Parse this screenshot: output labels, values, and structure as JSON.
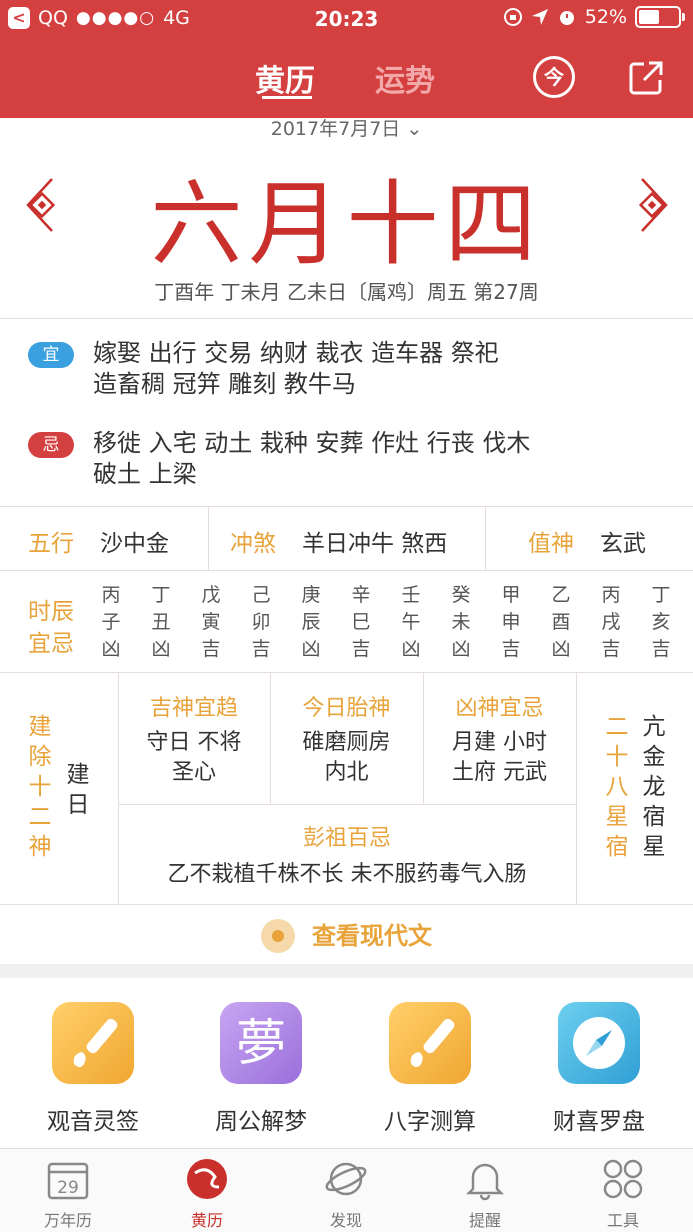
{
  "status_bar": {
    "carrier": "QQ",
    "signal": "●●●●○",
    "network": "4G",
    "time": "20:23",
    "battery": "52%",
    "battery_level": 0.52
  },
  "nav": {
    "tab_almanac": "黄历",
    "tab_fortune": "运势",
    "circle_icon_glyph": "今"
  },
  "date": {
    "solar": "2017年7月7日",
    "lunar": "六月十四",
    "ganzhi": "丁酉年 丁未月 乙未日〔属鸡〕周五  第27周"
  },
  "yi": {
    "badge": "宜",
    "line1": "嫁娶  出行  交易  纳财  裁衣  造车器  祭祀",
    "line2": "造畜稠  冠笄  雕刻  教牛马"
  },
  "ji": {
    "badge": "忌",
    "line1": "移徙  入宅  动土  栽种  安葬  作灶  行丧  伐木",
    "line2": "破土  上梁"
  },
  "row_info": {
    "wuxing_label": "五行",
    "wuxing_value": "沙中金",
    "chongsha_label": "冲煞",
    "chongsha_value": "羊日冲牛 煞西",
    "zhishen_label": "值神",
    "zhishen_value": "玄武"
  },
  "hours": {
    "label1": "时辰",
    "label2": "宜忌",
    "items": [
      [
        "丙",
        "子",
        "凶"
      ],
      [
        "丁",
        "丑",
        "凶"
      ],
      [
        "戊",
        "寅",
        "吉"
      ],
      [
        "己",
        "卯",
        "吉"
      ],
      [
        "庚",
        "辰",
        "凶"
      ],
      [
        "辛",
        "巳",
        "吉"
      ],
      [
        "壬",
        "午",
        "凶"
      ],
      [
        "癸",
        "未",
        "凶"
      ],
      [
        "甲",
        "申",
        "吉"
      ],
      [
        "乙",
        "酉",
        "凶"
      ],
      [
        "丙",
        "戌",
        "吉"
      ],
      [
        "丁",
        "亥",
        "吉"
      ]
    ]
  },
  "grid": {
    "jianchu_label": "建除十二神",
    "jianchu_value": "建日",
    "jishen_title": "吉神宜趋",
    "jishen_line1": "守日 不将",
    "jishen_line2": "圣心",
    "taishen_title": "今日胎神",
    "taishen_line1": "碓磨厕房",
    "taishen_line2": "内北",
    "xiongshen_title": "凶神宜忌",
    "xiongshen_line1": "月建 小时",
    "xiongshen_line2": "土府 元武",
    "pengzu_title": "彭祖百忌",
    "pengzu_text": "乙不栽植千株不长 未不服药毒气入肠",
    "xingxiu_label": "二十八星宿",
    "xingxiu_value": "亢金龙宿星"
  },
  "modern": {
    "label": "查看现代文"
  },
  "apps": [
    {
      "label": "观音灵签",
      "icon": "brush-icon"
    },
    {
      "label": "周公解梦",
      "icon": "dream-icon",
      "glyph": "夢"
    },
    {
      "label": "八字测算",
      "icon": "brush-icon"
    },
    {
      "label": "财喜罗盘",
      "icon": "compass-icon"
    }
  ],
  "tabbar": {
    "calendar_day": "29",
    "items": [
      "万年历",
      "黄历",
      "发现",
      "提醒",
      "工具"
    ]
  },
  "colors": {
    "brand_red": "#d43f3f",
    "gold": "#e8a33a",
    "lunar_red": "#c9302c",
    "yi_blue": "#3aa0e0"
  }
}
